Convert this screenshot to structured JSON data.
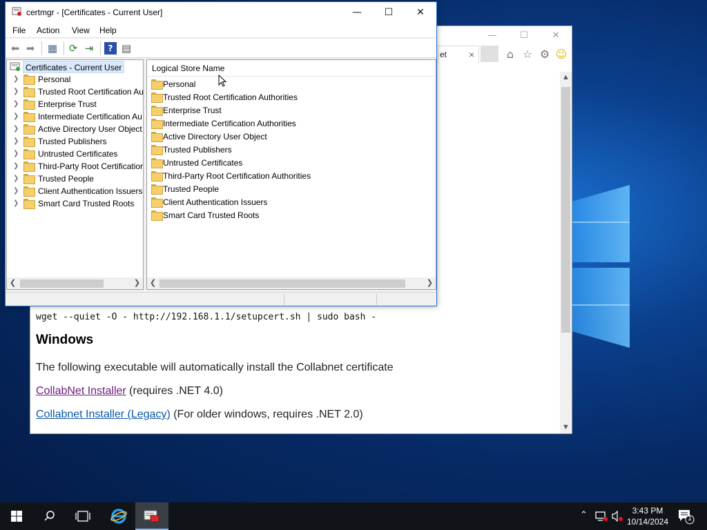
{
  "certmgr": {
    "title": "certmgr - [Certificates - Current User]",
    "menu": [
      "File",
      "Action",
      "View",
      "Help"
    ],
    "tree_root": "Certificates - Current User",
    "tree_items": [
      "Personal",
      "Trusted Root Certification Au",
      "Enterprise Trust",
      "Intermediate Certification Au",
      "Active Directory User Object",
      "Trusted Publishers",
      "Untrusted Certificates",
      "Third-Party Root Certificatior",
      "Trusted People",
      "Client Authentication Issuers",
      "Smart Card Trusted Roots"
    ],
    "column_header": "Logical Store Name",
    "list_items": [
      "Personal",
      "Trusted Root Certification Authorities",
      "Enterprise Trust",
      "Intermediate Certification Authorities",
      "Active Directory User Object",
      "Trusted Publishers",
      "Untrusted Certificates",
      "Third-Party Root Certification Authorities",
      "Trusted People",
      "Client Authentication Issuers",
      "Smart Card Trusted Roots"
    ]
  },
  "browser": {
    "tab_label": "et",
    "command": "wget --quiet -O - http://192.168.1.1/setupcert.sh | sudo bash -",
    "heading": "Windows",
    "description": "The following executable will automatically install the Collabnet certificate",
    "link1_text": "CollabNet Installer",
    "link1_suffix": " (requires .NET 4.0)",
    "link2_text": "Collabnet Installer (Legacy)",
    "link2_suffix": " (For older windows, requires .NET 2.0)"
  },
  "taskbar": {
    "time": "3:43 PM",
    "date": "10/14/2024",
    "notification_count": "1"
  },
  "colors": {
    "accent": "#1e70c8",
    "selection": "#d9e8fb",
    "visited_link": "#6a1b7a",
    "link": "#0b57a6",
    "taskbar": "#101418"
  }
}
